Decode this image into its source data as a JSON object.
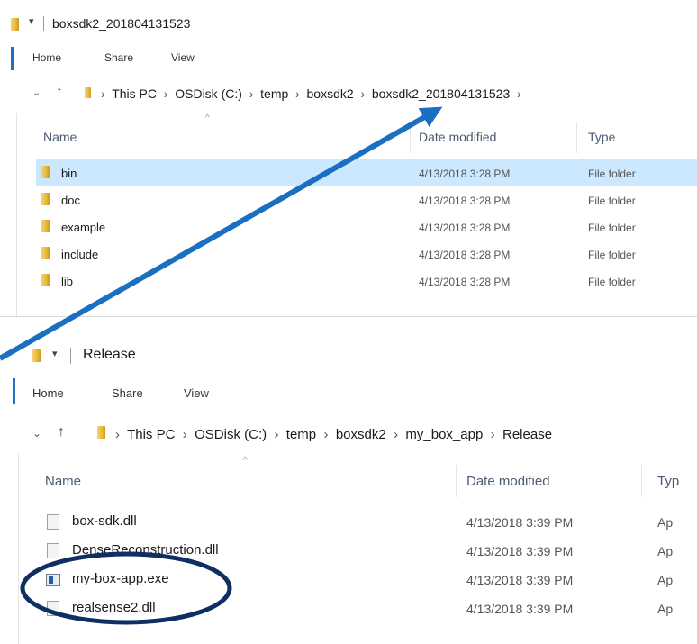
{
  "window1": {
    "title": "boxsdk2_201804131523",
    "tabs": [
      "Home",
      "Share",
      "View"
    ],
    "breadcrumb": [
      "This PC",
      "OSDisk (C:)",
      "temp",
      "boxsdk2",
      "boxsdk2_201804131523"
    ],
    "columns": [
      "Name",
      "Date modified",
      "Type"
    ],
    "rows": [
      {
        "name": "bin",
        "date": "4/13/2018 3:28 PM",
        "type": "File folder",
        "selected": true
      },
      {
        "name": "doc",
        "date": "4/13/2018 3:28 PM",
        "type": "File folder"
      },
      {
        "name": "example",
        "date": "4/13/2018 3:28 PM",
        "type": "File folder"
      },
      {
        "name": "include",
        "date": "4/13/2018 3:28 PM",
        "type": "File folder"
      },
      {
        "name": "lib",
        "date": "4/13/2018 3:28 PM",
        "type": "File folder"
      }
    ]
  },
  "window2": {
    "title": "Release",
    "tabs": [
      "Home",
      "Share",
      "View"
    ],
    "breadcrumb": [
      "This PC",
      "OSDisk (C:)",
      "temp",
      "boxsdk2",
      "my_box_app",
      "Release"
    ],
    "columns": [
      "Name",
      "Date modified",
      "Typ"
    ],
    "rows": [
      {
        "name": "box-sdk.dll",
        "date": "4/13/2018 3:39 PM",
        "type": "Ap",
        "icon": "dll-file-icon"
      },
      {
        "name": "DenseReconstruction.dll",
        "date": "4/13/2018 3:39 PM",
        "type": "Ap",
        "icon": "dll-file-icon"
      },
      {
        "name": "my-box-app.exe",
        "date": "4/13/2018 3:39 PM",
        "type": "Ap",
        "icon": "exe-file-icon"
      },
      {
        "name": "realsense2.dll",
        "date": "4/13/2018 3:39 PM",
        "type": "Ap",
        "icon": "dll-file-icon"
      }
    ]
  },
  "annotations": {
    "arrow_color": "#1a6fc0",
    "ellipse_color": "#0d2f61"
  }
}
